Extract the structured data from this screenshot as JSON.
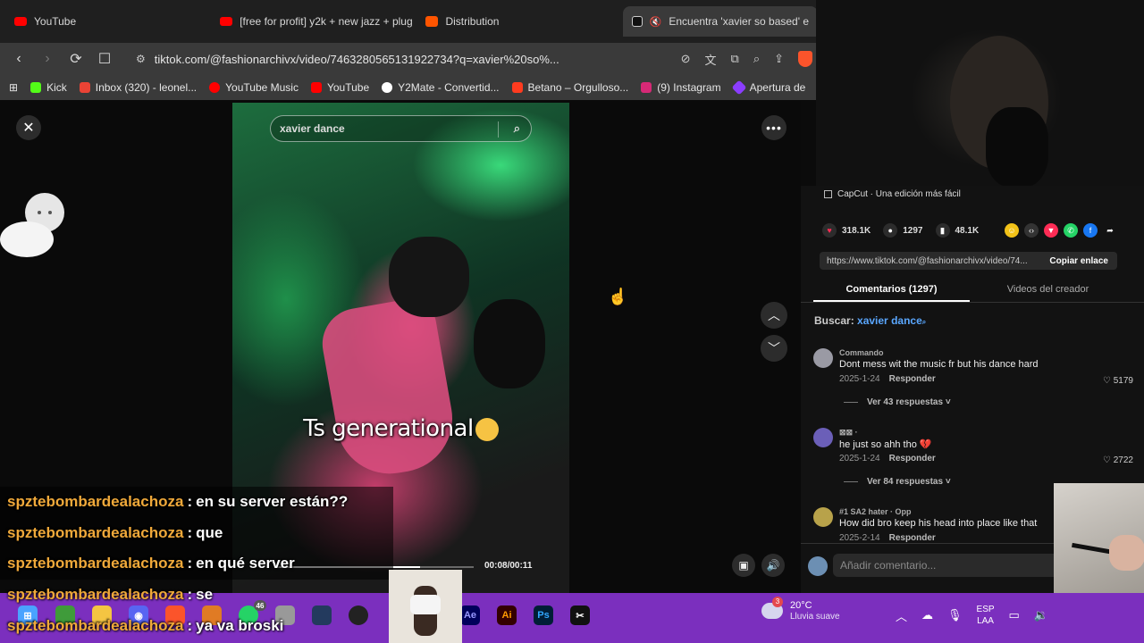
{
  "browser": {
    "tabs": [
      {
        "title": "YouTube",
        "favicon": "youtube-icon"
      },
      {
        "title": "[free for profit] y2k + new jazz + plug",
        "favicon": "youtube-icon"
      },
      {
        "title": "Distribution",
        "favicon": "soundcloud-icon"
      },
      {
        "title": "Encuentra 'xavier so based' e",
        "favicon": "tiktok-icon",
        "active": true
      }
    ],
    "url": "tiktok.com/@fashionarchivx/video/7463280565131922734?q=xavier%20so%...",
    "bookmarks": [
      {
        "label": "Kick",
        "color": "#53fc18"
      },
      {
        "label": "Inbox (320) - leonel...",
        "color": "#ea4335"
      },
      {
        "label": "YouTube Music",
        "color": "#ff0000"
      },
      {
        "label": "YouTube",
        "color": "#ff0000"
      },
      {
        "label": "Y2Mate - Convertid...",
        "color": "#ffffff"
      },
      {
        "label": "Betano – Orgulloso...",
        "color": "#ff3b1f"
      },
      {
        "label": "(9) Instagram",
        "color": "#d62976"
      },
      {
        "label": "Apertura de",
        "color": "#8b3dff"
      }
    ]
  },
  "viewer": {
    "search_query": "xavier dance",
    "caption": "Ts generational",
    "time": "00:08/00:11",
    "progress": 0.727
  },
  "panel": {
    "promo": "CapCut · Una edición más fácil",
    "likes": "318.1K",
    "comments_count": "1297",
    "saves": "48.1K",
    "share_link": "https://www.tiktok.com/@fashionarchivx/video/74...",
    "copy_label": "Copiar enlace",
    "tab_comments": "Comentarios (1297)",
    "tab_creator": "Videos del creador",
    "search_label": "Buscar:",
    "search_term": "xavier dance",
    "comments": [
      {
        "user": "Commando",
        "text": "Dont mess wit the music fr but his dance hard",
        "date": "2025-1-24",
        "reply": "Responder",
        "likes": "5179",
        "more": "Ver 43 respuestas"
      },
      {
        "user": "⊠⊠ ·",
        "text": "he just so ahh tho 💔",
        "date": "2025-1-24",
        "reply": "Responder",
        "likes": "2722",
        "more": "Ver 84 respuestas"
      },
      {
        "user": "#1 SA2 hater · Opp",
        "text": "How did bro keep his head into place like that",
        "date": "2025-2-14",
        "reply": "Responder"
      }
    ],
    "add_comment_placeholder": "Añadir comentario..."
  },
  "taskbar": {
    "weather_temp": "20°C",
    "weather_cond": "Lluvia suave",
    "weather_badge": "3",
    "lang_1": "ESP",
    "lang_2": "LAA",
    "app_ae": "Ae",
    "app_ai": "Ai",
    "app_ps": "Ps",
    "app_badge": "46"
  },
  "chat": [
    {
      "user": "spztebombardealachoza",
      "msg": "en su server están??"
    },
    {
      "user": "spztebombardealachoza",
      "msg": "que"
    },
    {
      "user": "spztebombardealachoza",
      "msg": "en qué server"
    },
    {
      "user": "spztebombardealachoza",
      "msg": "se"
    },
    {
      "user": "spztebombardealachoza",
      "msg": "ya va broski"
    }
  ],
  "chat_separator": ":"
}
